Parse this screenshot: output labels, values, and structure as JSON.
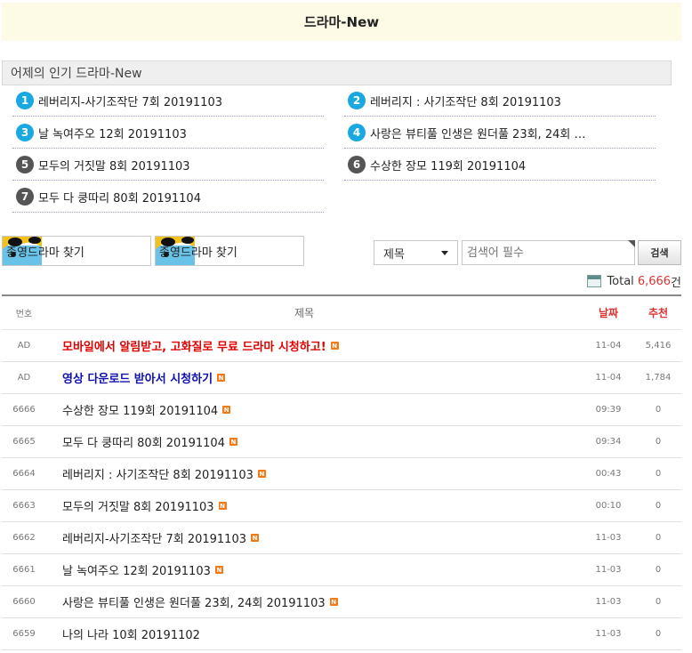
{
  "header": {
    "title": "드라마-New"
  },
  "popular": {
    "title": "어제의 인기 드라마-New",
    "items": [
      {
        "rank": "1",
        "title": "레버리지-사기조작단 7회 20191103"
      },
      {
        "rank": "2",
        "title": "레버리지 : 사기조작단 8회 20191103"
      },
      {
        "rank": "3",
        "title": "날 녹여주오 12회 20191103"
      },
      {
        "rank": "4",
        "title": "사랑은 뷰티풀 인생은 원더풀 23회, 24회 …"
      },
      {
        "rank": "5",
        "title": "모두의 거짓말 8회 20191103"
      },
      {
        "rank": "6",
        "title": "수상한 장모 119회 20191104"
      },
      {
        "rank": "7",
        "title": "모두 다 쿵따리 80회 20191104"
      }
    ]
  },
  "finders": [
    {
      "label": "종영드라마 찾기"
    },
    {
      "label": "종영드라마 찾기"
    }
  ],
  "search": {
    "field_selected": "제목",
    "placeholder": "검색어 필수",
    "button_label": "검색"
  },
  "total": {
    "label": "Total",
    "count": "6,666",
    "unit": "건"
  },
  "board": {
    "columns": {
      "num": "번호",
      "title": "제목",
      "date": "날짜",
      "rec": "추천"
    },
    "new_badge": "N",
    "rows": [
      {
        "num": "AD",
        "title": "모바일에서 알림받고, 고화질로 무료 드라마 시청하고!",
        "date": "11-04",
        "rec": "5,416"
      },
      {
        "num": "AD",
        "title": "영상 다운로드 받아서 시청하기",
        "date": "11-04",
        "rec": "1,784"
      },
      {
        "num": "6666",
        "title": "수상한 장모 119회 20191104",
        "date": "09:39",
        "rec": "0"
      },
      {
        "num": "6665",
        "title": "모두 다 쿵따리 80회 20191104",
        "date": "09:34",
        "rec": "0"
      },
      {
        "num": "6664",
        "title": "레버리지 : 사기조작단 8회 20191103",
        "date": "00:43",
        "rec": "0"
      },
      {
        "num": "6663",
        "title": "모두의 거짓말 8회 20191103",
        "date": "00:10",
        "rec": "0"
      },
      {
        "num": "6662",
        "title": "레버리지-사기조작단 7회 20191103",
        "date": "11-03",
        "rec": "0"
      },
      {
        "num": "6661",
        "title": "날 녹여주오 12회 20191103",
        "date": "11-03",
        "rec": "0"
      },
      {
        "num": "6660",
        "title": "사랑은 뷰티풀 인생은 원더풀 23회, 24회 20191103",
        "date": "11-03",
        "rec": "0"
      },
      {
        "num": "6659",
        "title": "나의 나라 10회 20191102",
        "date": "11-03",
        "rec": "0"
      }
    ]
  }
}
